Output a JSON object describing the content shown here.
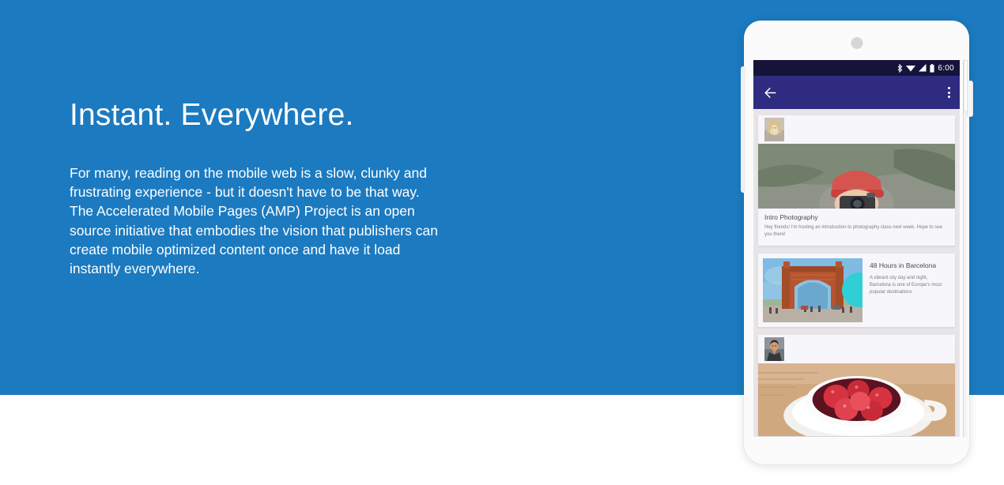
{
  "hero": {
    "title": "Instant. Everywhere.",
    "paragraph": "For many, reading on the mobile web is a slow, clunky and frustrating experience - but it doesn't have to be that way. The Accelerated Mobile Pages (AMP) Project is an open source initiative that embodies the vision that publishers can create mobile optimized content once and have it load instantly everywhere.",
    "background_color": "#1b7ac0",
    "text_color": "#ffffff"
  },
  "phone": {
    "frame_color": "#fbfbfb",
    "speaker_icon": "camera-dot-icon",
    "status_bar": {
      "background_color": "#151339",
      "time": "6:00",
      "icons": [
        "bluetooth-icon",
        "wifi-icon",
        "signal-icon",
        "battery-icon"
      ]
    },
    "app_bar": {
      "background_color": "#2e2b80",
      "back_icon": "back-arrow-icon",
      "overflow_icon": "overflow-menu-icon"
    },
    "feed": {
      "background_color": "#e8e5e8",
      "card_color": "#f7f6fa",
      "accent_color": "#2fcfd6",
      "cards": [
        {
          "type": "vertical",
          "avatar": "user-avatar-blonde",
          "image": "photographer-in-red-beanie",
          "title": "Intro Photography",
          "body": "Hey friends! I'm hosting an introduction to photography class next week. Hope to see you there!"
        },
        {
          "type": "horizontal",
          "image": "arc-de-triomf-barcelona",
          "title": "48 Hours in Barcelona",
          "body": "A vibrant city day and night, Barcelona is one of Europe's most popular destinations",
          "bubble": "teal-circle-overlay"
        },
        {
          "type": "vertical",
          "avatar": "user-avatar-man",
          "image": "raspberries-in-teacup",
          "title": "",
          "body": ""
        }
      ]
    },
    "scrollbar": {
      "name": "vertical-scrollbar"
    }
  }
}
